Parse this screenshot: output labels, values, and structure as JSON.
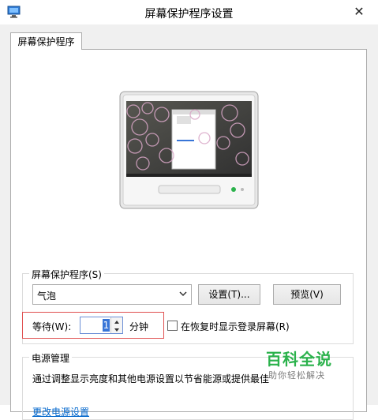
{
  "window": {
    "title": "屏幕保护程序设置"
  },
  "tabs": [
    {
      "label": "屏幕保护程序"
    }
  ],
  "screensaver_group": {
    "label": "屏幕保护程序(S)",
    "selected": "气泡",
    "settings_button": "设置(T)...",
    "preview_button": "预览(V)",
    "wait_label": "等待(W):",
    "wait_value": "1",
    "wait_unit": "分钟",
    "resume_checkbox_label": "在恢复时显示登录屏幕(R)"
  },
  "power_group": {
    "label": "电源管理",
    "description": "通过调整显示亮度和其他电源设置以节省能源或提供最佳",
    "link": "更改电源设置"
  },
  "watermark": {
    "title": "百科全说",
    "subtitle": "助你轻松解决"
  },
  "colors": {
    "accent": "#3875d7",
    "highlight_border": "#e05050",
    "link": "#0066cc",
    "watermark": "#2bb24c"
  }
}
